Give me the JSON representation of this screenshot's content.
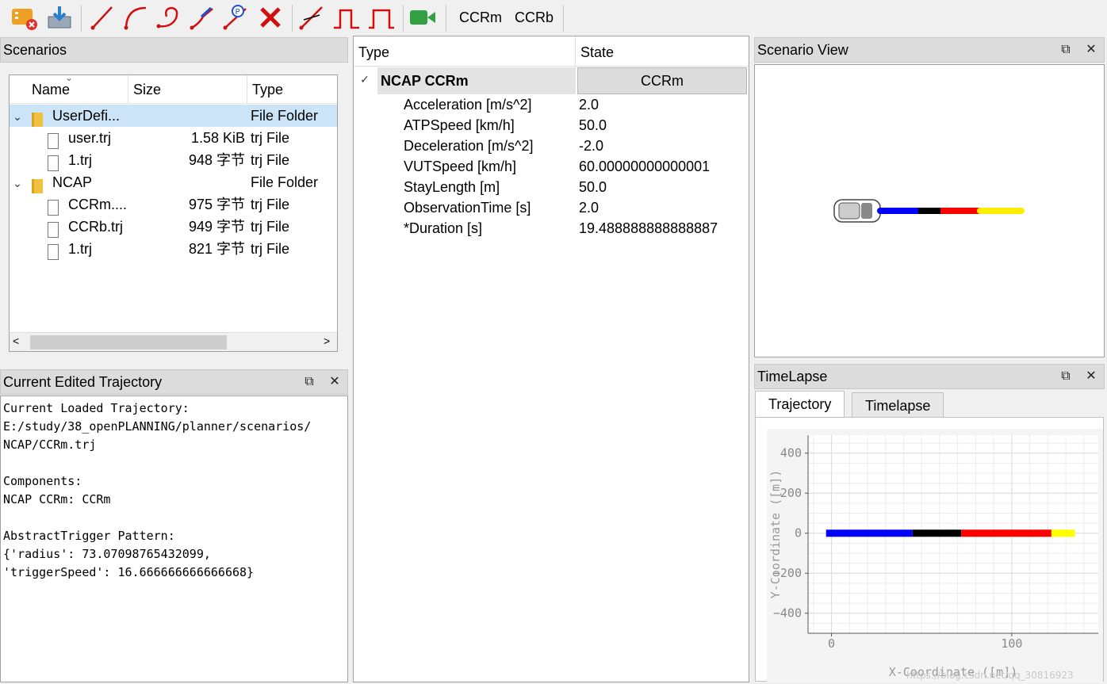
{
  "toolbar": {
    "icons": [
      "ticket-delete-icon",
      "import-icon",
      "line-tool-icon",
      "curve-tool-icon",
      "loop-tool-icon",
      "ramp-tool-icon",
      "parking-tool-icon",
      "delete-tool-icon",
      "cut-tool-icon",
      "pulse-tool-icon",
      "pulse2-tool-icon",
      "camera-icon"
    ],
    "preset_a": "CCRm",
    "preset_b": "CCRb"
  },
  "scenarios": {
    "title": "Scenarios",
    "columns": [
      "Name",
      "Size",
      "Type"
    ],
    "rows": [
      {
        "name": "UserDefi...",
        "size": "",
        "type": "File Folder",
        "kind": "folder",
        "level": 0
      },
      {
        "name": "user.trj",
        "size": "1.58 KiB",
        "type": "trj File",
        "kind": "file",
        "level": 1
      },
      {
        "name": "1.trj",
        "size": "948 字节",
        "type": "trj File",
        "kind": "file",
        "level": 1
      },
      {
        "name": "NCAP",
        "size": "",
        "type": "File Folder",
        "kind": "folder",
        "level": 0
      },
      {
        "name": "CCRm....",
        "size": "975 字节",
        "type": "trj File",
        "kind": "file",
        "level": 1
      },
      {
        "name": "CCRb.trj",
        "size": "949 字节",
        "type": "trj File",
        "kind": "file",
        "level": 1
      },
      {
        "name": "1.trj",
        "size": "821 字节",
        "type": "trj File",
        "kind": "file",
        "level": 1
      }
    ]
  },
  "trajectory": {
    "title": "Current Edited Trajectory",
    "text": "Current Loaded Trajectory:\nE:/study/38_openPLANNING/planner/scenarios/\nNCAP/CCRm.trj\n\nComponents:\nNCAP CCRm: CCRm\n\nAbstractTrigger Pattern:\n{'radius': 73.07098765432099,\n'triggerSpeed': 16.666666666666668}"
  },
  "properties": {
    "col_type": "Type",
    "col_state": "State",
    "group_name": "NCAP CCRm",
    "group_state": "CCRm",
    "rows": [
      {
        "name": "Acceleration [m/s^2]",
        "value": "2.0"
      },
      {
        "name": "ATPSpeed [km/h]",
        "value": "50.0"
      },
      {
        "name": "Deceleration [m/s^2]",
        "value": "-2.0"
      },
      {
        "name": "VUTSpeed [km/h]",
        "value": "60.00000000000001"
      },
      {
        "name": "StayLength [m]",
        "value": "50.0"
      },
      {
        "name": "ObservationTime [s]",
        "value": "2.0"
      },
      {
        "name": "*Duration [s]",
        "value": "19.488888888888887"
      }
    ]
  },
  "scenario_view": {
    "title": "Scenario View"
  },
  "timelapse": {
    "title": "TimeLapse",
    "tabs": [
      "Trajectory",
      "Timelapse"
    ],
    "active_tab": "Trajectory",
    "watermark": "https://blog.csdn.net/qq_30816923"
  },
  "chart_data": {
    "type": "line",
    "xlabel": "X-Coordinate ([m])",
    "ylabel": "Y-Coordinate ([m])",
    "xlim": [
      -13,
      148
    ],
    "ylim": [
      -500,
      490
    ],
    "xticks": [
      0,
      100
    ],
    "yticks": [
      400,
      200,
      0,
      -200,
      -400
    ],
    "grid": true,
    "segments": [
      {
        "color": "#0000ff",
        "x": [
          -3,
          45
        ],
        "y": [
          0,
          0
        ]
      },
      {
        "color": "#000000",
        "x": [
          45,
          72
        ],
        "y": [
          0,
          0
        ]
      },
      {
        "color": "#ff0000",
        "x": [
          72,
          122
        ],
        "y": [
          0,
          0
        ]
      },
      {
        "color": "#ffff00",
        "x": [
          122,
          175
        ],
        "y": [
          0,
          0
        ]
      }
    ]
  }
}
